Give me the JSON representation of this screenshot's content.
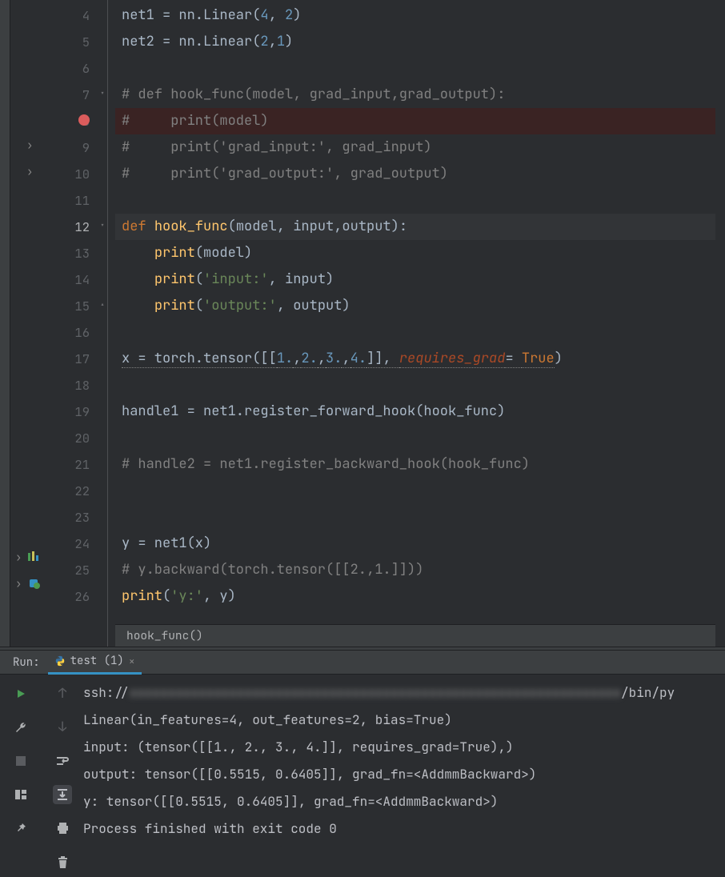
{
  "editor": {
    "lines": [
      {
        "n": 4,
        "html": "<span class='ident'>net1 = nn.Linear(</span><span class='num'>4</span><span class='ident'>, </span><span class='num'>2</span><span class='ident'>)</span>"
      },
      {
        "n": 5,
        "html": "<span class='ident'>net2 = nn.Linear(</span><span class='num'>2</span><span class='ident'>,</span><span class='num'>1</span><span class='ident'>)</span>"
      },
      {
        "n": 6,
        "html": ""
      },
      {
        "n": 7,
        "html": "<span class='cm'># def hook_func(model, grad_input,grad_output):</span>",
        "fold": "down"
      },
      {
        "n": 8,
        "html": "<span class='cm'>#     print(model)</span>",
        "bp": true
      },
      {
        "n": 9,
        "html": "<span class='cm'>#     print('grad_input:', grad_input)</span>",
        "chev": true
      },
      {
        "n": 10,
        "html": "<span class='cm'>#     print('grad_output:', grad_output)</span>",
        "chev": true
      },
      {
        "n": 11,
        "html": ""
      },
      {
        "n": 12,
        "html": "<span class='kw'>def </span><span class='fn'>hook_func</span><span class='ident'>(model, input,output):</span>",
        "fold": "down",
        "current": true
      },
      {
        "n": 13,
        "html": "    <span class='fn'>print</span><span class='ident'>(model)</span>"
      },
      {
        "n": 14,
        "html": "    <span class='fn'>print</span><span class='ident'>(</span><span class='str'>'input:'</span><span class='ident'>, input)</span>"
      },
      {
        "n": 15,
        "html": "    <span class='fn'>print</span><span class='ident'>(</span><span class='str'>'output:'</span><span class='ident'>, output)</span>",
        "fold": "up"
      },
      {
        "n": 16,
        "html": ""
      },
      {
        "n": 17,
        "html": "<span class='ident dot-underline'>x = torch.tensor([[</span><span class='num dot-underline'>1.</span><span class='ident dot-underline'>,</span><span class='num dot-underline'>2.</span><span class='ident dot-underline'>,</span><span class='num dot-underline'>3.</span><span class='ident dot-underline'>,</span><span class='num dot-underline'>4.</span><span class='ident dot-underline'>]], </span><span class='kwarg dot-underline'>requires_grad</span><span class='ident dot-underline'>= </span><span class='bool dot-underline'>True</span><span class='ident'>)</span>"
      },
      {
        "n": 18,
        "html": ""
      },
      {
        "n": 19,
        "html": "<span class='ident'>handle1 = net1.register_forward_hook(hook_func)</span>"
      },
      {
        "n": 20,
        "html": ""
      },
      {
        "n": 21,
        "html": "<span class='cm'># handle2 = net1.register_backward_hook(hook_func)</span>"
      },
      {
        "n": 22,
        "html": ""
      },
      {
        "n": 23,
        "html": ""
      },
      {
        "n": 24,
        "html": "<span class='ident'>y = net1(x)</span>"
      },
      {
        "n": 25,
        "html": "<span class='cm'># y.backward(torch.tensor([[2.,1.]]))</span>"
      },
      {
        "n": 26,
        "html": "<span class='fn'>print</span><span class='ident'>(</span><span class='str'>'y:'</span><span class='ident'>, y)</span>"
      }
    ],
    "breadcrumb": "hook_func()"
  },
  "run": {
    "label": "Run:",
    "tab": "test (1)",
    "console": [
      "ssh://████████████████████████████████████████████████████████████/bin/py",
      "Linear(in_features=4, out_features=2, bias=True)",
      "input: (tensor([[1., 2., 3., 4.]], requires_grad=True),)",
      "output: tensor([[0.5515, 0.6405]], grad_fn=<AddmmBackward>)",
      "y: tensor([[0.5515, 0.6405]], grad_fn=<AddmmBackward>)",
      "",
      "Process finished with exit code 0"
    ]
  }
}
